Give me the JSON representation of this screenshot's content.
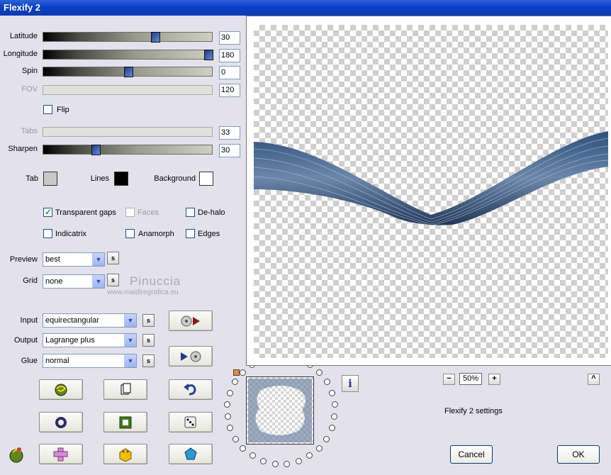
{
  "window": {
    "title": "Flexify 2"
  },
  "sliders": [
    {
      "label": "Latitude",
      "value": "30",
      "fraction": 0.66,
      "disabled": false
    },
    {
      "label": "Longitude",
      "value": "180",
      "fraction": 1.0,
      "disabled": false
    },
    {
      "label": "Spin",
      "value": "0",
      "fraction": 0.5,
      "disabled": false
    },
    {
      "label": "FOV",
      "value": "120",
      "fraction": null,
      "disabled": true
    },
    {
      "label": "Tabs",
      "value": "33",
      "fraction": null,
      "disabled": true
    },
    {
      "label": "Sharpen",
      "value": "30",
      "fraction": 0.3,
      "disabled": false
    }
  ],
  "flip": {
    "label": "Flip",
    "checked": false
  },
  "colors": {
    "tab": {
      "label": "Tab",
      "value": "#c8c8c8"
    },
    "lines": {
      "label": "Lines",
      "value": "#000000"
    },
    "background": {
      "label": "Background",
      "value": "#ffffff"
    }
  },
  "options": {
    "transparent_gaps": {
      "label": "Transparent gaps",
      "checked": true
    },
    "faces": {
      "label": "Faces",
      "checked": false
    },
    "de_halo": {
      "label": "De-halo",
      "checked": false
    },
    "indicatrix": {
      "label": "Indicatrix",
      "checked": false
    },
    "anamorph": {
      "label": "Anamorph",
      "checked": false
    },
    "edges": {
      "label": "Edges",
      "checked": false
    }
  },
  "preview_select": {
    "label": "Preview",
    "value": "best",
    "s": "s"
  },
  "grid_select": {
    "label": "Grid",
    "value": "none",
    "s": "s"
  },
  "input_select": {
    "label": "Input",
    "value": "equirectangular",
    "s": "s"
  },
  "output_select": {
    "label": "Output",
    "value": "Lagrange plus",
    "s": "s"
  },
  "glue_select": {
    "label": "Glue",
    "value": "normal",
    "s": "s"
  },
  "watermark": {
    "name": "Pinuccia",
    "url": "www.maidiregrafica.eu"
  },
  "zoom": {
    "minus": "−",
    "value": "50%",
    "plus": "+",
    "up": "^"
  },
  "info": {
    "icon": "i"
  },
  "status_text": "Flexify 2 settings",
  "buttons": {
    "cancel": "Cancel",
    "ok": "OK"
  }
}
